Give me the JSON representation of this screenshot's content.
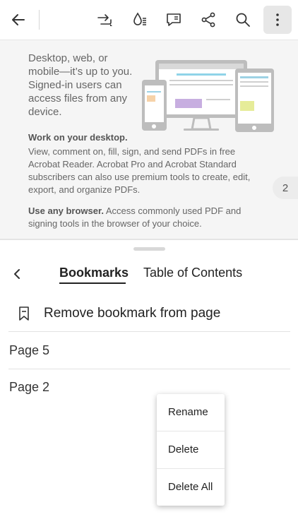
{
  "toolbar": {
    "icons": [
      "back-arrow-icon",
      "share-export-icon",
      "liquid-mode-icon",
      "comment-icon",
      "share-icon",
      "search-icon",
      "more-icon"
    ]
  },
  "document": {
    "intro": "Desktop, web, or mobile—it’s up to you. Signed-in users can access files from any device.",
    "desktop_heading": "Work on your desktop.",
    "desktop_body": "View, comment on, fill, sign, and send PDFs in free Acrobat Reader. Acrobat Pro and Acrobat Standard subscribers can also use premium tools to create, edit, export, and organize PDFs.",
    "browser_heading": "Use any browser.",
    "browser_body": " Access commonly used PDF and signing tools in the browser of your choice.",
    "page_badge": "2"
  },
  "panel": {
    "tabs": [
      {
        "label": "Bookmarks",
        "active": true
      },
      {
        "label": "Table of Contents",
        "active": false
      }
    ],
    "remove_label": "Remove bookmark from page",
    "bookmarks": [
      "Page 5",
      "Page 2"
    ]
  },
  "context_menu": {
    "items": [
      "Rename",
      "Delete",
      "Delete All"
    ]
  }
}
